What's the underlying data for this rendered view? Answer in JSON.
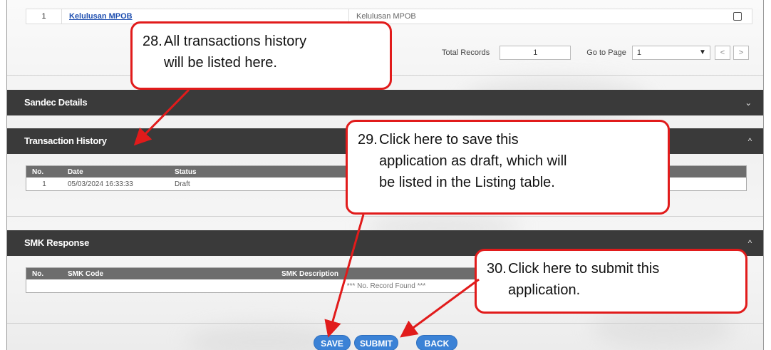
{
  "top_table": {
    "row": {
      "no": "1",
      "link": "Kelulusan MPOB",
      "desc": "Kelulusan MPOB"
    },
    "total_records_label": "Total Records",
    "total_records_value": "1",
    "go_to_page_label": "Go to Page",
    "page_value": "1",
    "prev_glyph": "<",
    "next_glyph": ">"
  },
  "sections": {
    "sandec": {
      "title": "Sandec Details",
      "chevron": "⌄"
    },
    "transaction": {
      "title": "Transaction History",
      "chevron": "^"
    },
    "smk": {
      "title": "SMK Response",
      "chevron": "^"
    }
  },
  "transaction_table": {
    "columns": [
      "No.",
      "Date",
      "Status"
    ],
    "rows": [
      [
        "1",
        "05/03/2024 16:33:33",
        "Draft"
      ]
    ]
  },
  "smk_table": {
    "columns": [
      "No.",
      "SMK Code",
      "SMK Description"
    ],
    "empty": "*** No. Record Found ***"
  },
  "buttons": {
    "save": "SAVE",
    "submit": "SUBMIT",
    "back": "BACK"
  },
  "callouts": {
    "c28": {
      "num": "28.",
      "line1": "All transactions history",
      "line2": "will be listed here."
    },
    "c29": {
      "num": "29.",
      "line1": "Click here to save this",
      "line2": "application as draft, which will",
      "line3": "be listed in the Listing table."
    },
    "c30": {
      "num": "30.",
      "line1": "Click here to submit this",
      "line2": "application."
    }
  },
  "colors": {
    "callout_border": "#e11b1b",
    "button_blue": "#3b82d6",
    "section_bar": "#3a3a3a"
  }
}
